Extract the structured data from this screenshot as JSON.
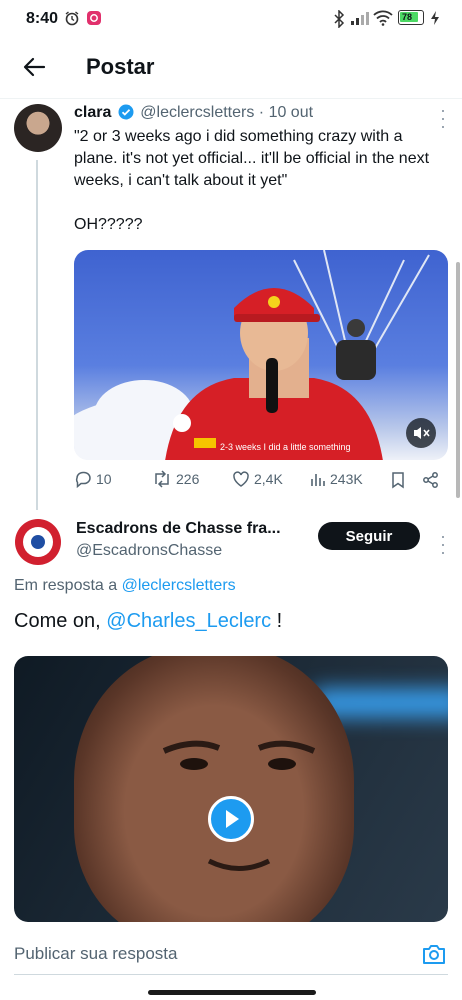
{
  "status_bar": {
    "time": "8:40",
    "battery": "78"
  },
  "header": {
    "title": "Postar"
  },
  "post1": {
    "name": "clara",
    "handle": "@leclercsletters",
    "separator": "·",
    "time": "10 out",
    "text_lines": [
      "\"2 or 3 weeks ago i did something crazy with a plane. it's not yet official... it'll be official in the next weeks, i can't talk about it yet\"",
      "OH?????"
    ],
    "video_caption": "2-3 weeks I did a little something",
    "stats": {
      "replies": "10",
      "reposts": "226",
      "likes": "2,4K",
      "views": "243K"
    }
  },
  "post2": {
    "name": "Escadrons de Chasse fra...",
    "handle": "@EscadronsChasse",
    "follow_label": "Seguir",
    "reply_prefix": "Em resposta a",
    "reply_handle": "@leclercsletters",
    "text_prefix": "Come on,",
    "mention": "@Charles_Leclerc",
    "text_suffix": "!"
  },
  "reply_bar": {
    "placeholder": "Publicar sua resposta"
  },
  "colors": {
    "accent": "#1d9bf0",
    "text": "#0f1419",
    "secondary": "#536471",
    "roundel_red": "#d1202f",
    "roundel_blue": "#1f4ea3"
  },
  "icons": [
    "back-arrow-icon",
    "verified-icon",
    "more-icon",
    "mute-icon",
    "reply-icon",
    "repost-icon",
    "like-icon",
    "views-icon",
    "bookmark-icon",
    "share-icon",
    "play-icon",
    "camera-icon"
  ]
}
